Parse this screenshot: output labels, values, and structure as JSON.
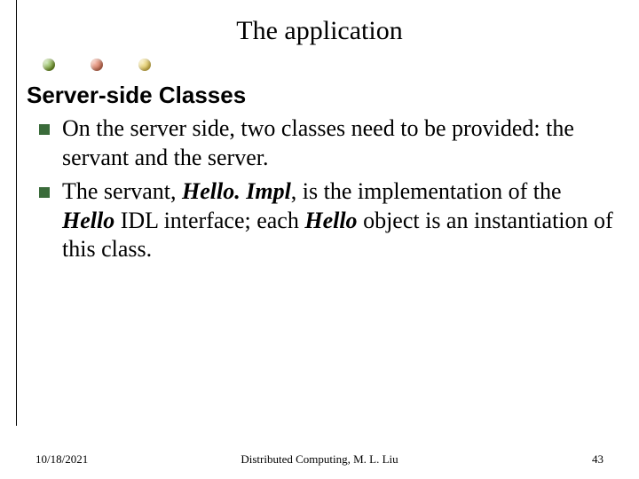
{
  "title": "The application",
  "subheading": "Server-side Classes",
  "bullets": [
    {
      "segments": [
        {
          "t": " On the server side, two classes need to be provided: the servant and the server."
        }
      ]
    },
    {
      "segments": [
        {
          "t": "The servant, "
        },
        {
          "t": "Hello. Impl",
          "style": "bi"
        },
        {
          "t": ", is the implementation of the "
        },
        {
          "t": "Hello",
          "style": "bi"
        },
        {
          "t": " IDL interface; each "
        },
        {
          "t": "Hello",
          "style": "bi"
        },
        {
          "t": " object is an instantiation of this class."
        }
      ]
    }
  ],
  "footer": {
    "date": "10/18/2021",
    "center": "Distributed Computing, M. L. Liu",
    "page": "43"
  }
}
